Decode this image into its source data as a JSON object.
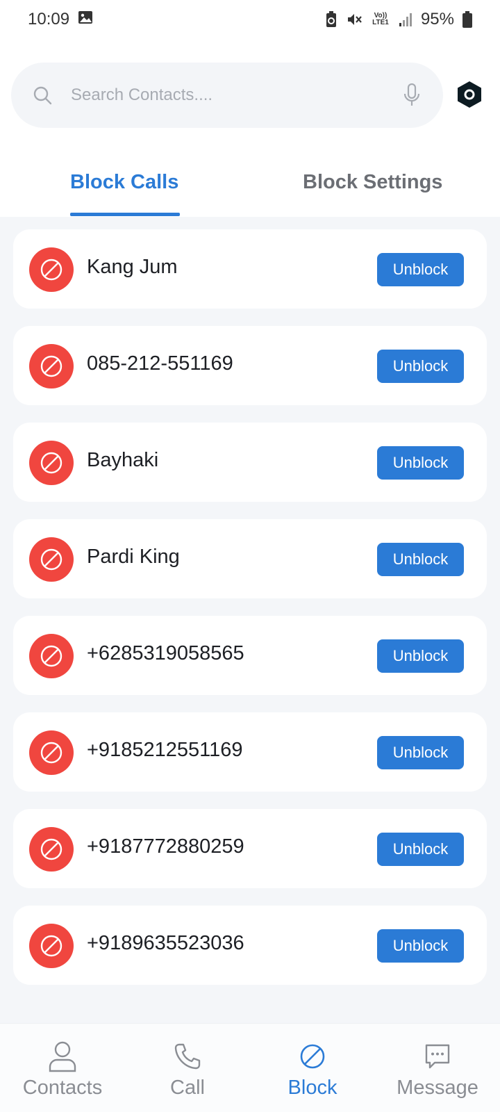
{
  "status_bar": {
    "time": "10:09",
    "battery": "95%",
    "network": "Vo)) LTE1",
    "icons": [
      "gallery-icon",
      "battery-saver-icon",
      "mute-icon",
      "volte-icon",
      "signal-icon",
      "battery-icon"
    ]
  },
  "search": {
    "placeholder": "Search Contacts...."
  },
  "tabs": [
    {
      "label": "Block Calls",
      "active": true
    },
    {
      "label": "Block Settings",
      "active": false
    }
  ],
  "blocked_list": [
    {
      "name": "Kang Jum",
      "action": "Unblock"
    },
    {
      "name": "085-212-551169",
      "action": "Unblock"
    },
    {
      "name": "Bayhaki",
      "action": "Unblock"
    },
    {
      "name": "Pardi King",
      "action": "Unblock"
    },
    {
      "name": "+6285319058565",
      "action": "Unblock"
    },
    {
      "name": "+9185212551169",
      "action": "Unblock"
    },
    {
      "name": "+9187772880259",
      "action": "Unblock"
    },
    {
      "name": "+9189635523036",
      "action": "Unblock"
    }
  ],
  "bottom_nav": [
    {
      "label": "Contacts",
      "icon": "person-icon",
      "active": false
    },
    {
      "label": "Call",
      "icon": "phone-icon",
      "active": false
    },
    {
      "label": "Block",
      "icon": "block-icon",
      "active": true
    },
    {
      "label": "Message",
      "icon": "message-icon",
      "active": false
    }
  ],
  "colors": {
    "accent": "#2b7bd6",
    "block_red": "#f0463f",
    "list_background": "#f4f6f9"
  }
}
